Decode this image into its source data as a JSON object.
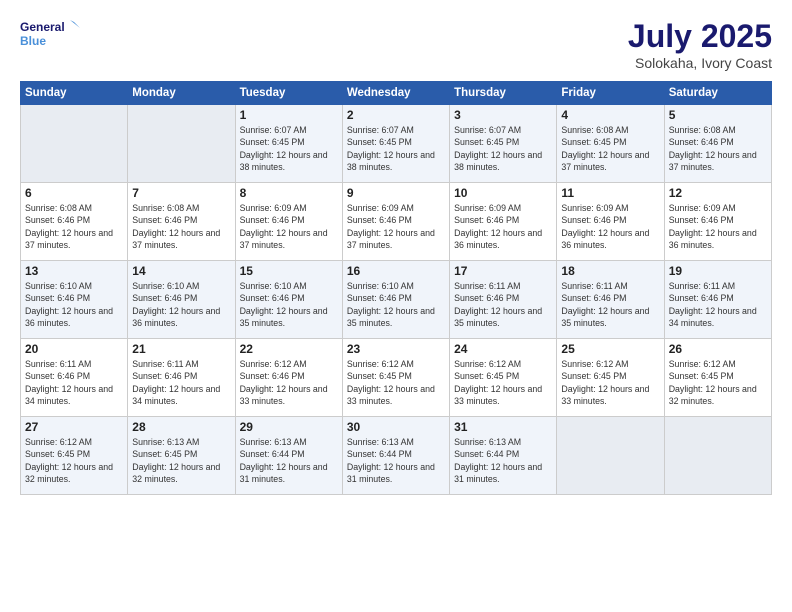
{
  "logo": {
    "line1": "General",
    "line2": "Blue"
  },
  "title": "July 2025",
  "subtitle": "Solokaha, Ivory Coast",
  "weekdays": [
    "Sunday",
    "Monday",
    "Tuesday",
    "Wednesday",
    "Thursday",
    "Friday",
    "Saturday"
  ],
  "weeks": [
    [
      {
        "day": "",
        "empty": true
      },
      {
        "day": "",
        "empty": true
      },
      {
        "day": "1",
        "sunrise": "6:07 AM",
        "sunset": "6:45 PM",
        "daylight": "12 hours and 38 minutes."
      },
      {
        "day": "2",
        "sunrise": "6:07 AM",
        "sunset": "6:45 PM",
        "daylight": "12 hours and 38 minutes."
      },
      {
        "day": "3",
        "sunrise": "6:07 AM",
        "sunset": "6:45 PM",
        "daylight": "12 hours and 38 minutes."
      },
      {
        "day": "4",
        "sunrise": "6:08 AM",
        "sunset": "6:45 PM",
        "daylight": "12 hours and 37 minutes."
      },
      {
        "day": "5",
        "sunrise": "6:08 AM",
        "sunset": "6:46 PM",
        "daylight": "12 hours and 37 minutes."
      }
    ],
    [
      {
        "day": "6",
        "sunrise": "6:08 AM",
        "sunset": "6:46 PM",
        "daylight": "12 hours and 37 minutes."
      },
      {
        "day": "7",
        "sunrise": "6:08 AM",
        "sunset": "6:46 PM",
        "daylight": "12 hours and 37 minutes."
      },
      {
        "day": "8",
        "sunrise": "6:09 AM",
        "sunset": "6:46 PM",
        "daylight": "12 hours and 37 minutes."
      },
      {
        "day": "9",
        "sunrise": "6:09 AM",
        "sunset": "6:46 PM",
        "daylight": "12 hours and 37 minutes."
      },
      {
        "day": "10",
        "sunrise": "6:09 AM",
        "sunset": "6:46 PM",
        "daylight": "12 hours and 36 minutes."
      },
      {
        "day": "11",
        "sunrise": "6:09 AM",
        "sunset": "6:46 PM",
        "daylight": "12 hours and 36 minutes."
      },
      {
        "day": "12",
        "sunrise": "6:09 AM",
        "sunset": "6:46 PM",
        "daylight": "12 hours and 36 minutes."
      }
    ],
    [
      {
        "day": "13",
        "sunrise": "6:10 AM",
        "sunset": "6:46 PM",
        "daylight": "12 hours and 36 minutes."
      },
      {
        "day": "14",
        "sunrise": "6:10 AM",
        "sunset": "6:46 PM",
        "daylight": "12 hours and 36 minutes."
      },
      {
        "day": "15",
        "sunrise": "6:10 AM",
        "sunset": "6:46 PM",
        "daylight": "12 hours and 35 minutes."
      },
      {
        "day": "16",
        "sunrise": "6:10 AM",
        "sunset": "6:46 PM",
        "daylight": "12 hours and 35 minutes."
      },
      {
        "day": "17",
        "sunrise": "6:11 AM",
        "sunset": "6:46 PM",
        "daylight": "12 hours and 35 minutes."
      },
      {
        "day": "18",
        "sunrise": "6:11 AM",
        "sunset": "6:46 PM",
        "daylight": "12 hours and 35 minutes."
      },
      {
        "day": "19",
        "sunrise": "6:11 AM",
        "sunset": "6:46 PM",
        "daylight": "12 hours and 34 minutes."
      }
    ],
    [
      {
        "day": "20",
        "sunrise": "6:11 AM",
        "sunset": "6:46 PM",
        "daylight": "12 hours and 34 minutes."
      },
      {
        "day": "21",
        "sunrise": "6:11 AM",
        "sunset": "6:46 PM",
        "daylight": "12 hours and 34 minutes."
      },
      {
        "day": "22",
        "sunrise": "6:12 AM",
        "sunset": "6:46 PM",
        "daylight": "12 hours and 33 minutes."
      },
      {
        "day": "23",
        "sunrise": "6:12 AM",
        "sunset": "6:45 PM",
        "daylight": "12 hours and 33 minutes."
      },
      {
        "day": "24",
        "sunrise": "6:12 AM",
        "sunset": "6:45 PM",
        "daylight": "12 hours and 33 minutes."
      },
      {
        "day": "25",
        "sunrise": "6:12 AM",
        "sunset": "6:45 PM",
        "daylight": "12 hours and 33 minutes."
      },
      {
        "day": "26",
        "sunrise": "6:12 AM",
        "sunset": "6:45 PM",
        "daylight": "12 hours and 32 minutes."
      }
    ],
    [
      {
        "day": "27",
        "sunrise": "6:12 AM",
        "sunset": "6:45 PM",
        "daylight": "12 hours and 32 minutes."
      },
      {
        "day": "28",
        "sunrise": "6:13 AM",
        "sunset": "6:45 PM",
        "daylight": "12 hours and 32 minutes."
      },
      {
        "day": "29",
        "sunrise": "6:13 AM",
        "sunset": "6:44 PM",
        "daylight": "12 hours and 31 minutes."
      },
      {
        "day": "30",
        "sunrise": "6:13 AM",
        "sunset": "6:44 PM",
        "daylight": "12 hours and 31 minutes."
      },
      {
        "day": "31",
        "sunrise": "6:13 AM",
        "sunset": "6:44 PM",
        "daylight": "12 hours and 31 minutes."
      },
      {
        "day": "",
        "empty": true
      },
      {
        "day": "",
        "empty": true
      }
    ]
  ],
  "labels": {
    "sunrise": "Sunrise: ",
    "sunset": "Sunset: ",
    "daylight": "Daylight: "
  }
}
